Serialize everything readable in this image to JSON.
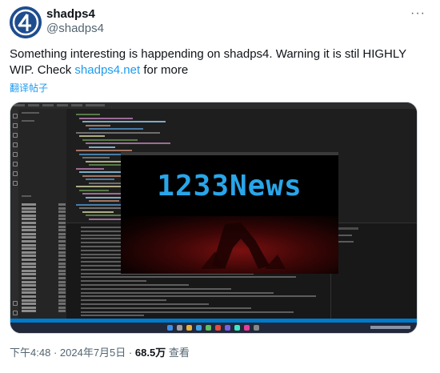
{
  "header": {
    "display_name": "shadps4",
    "handle": "@shadps4",
    "more_icon": "more-horizontal-icon"
  },
  "tweet": {
    "text_before": "Something interesting is happending on shadps4. Warning it is stil HIGHLY WIP. Check ",
    "link_text": "shadps4.net",
    "text_after": " for more",
    "translate_label": "翻译帖子"
  },
  "media": {
    "emulator_logo_text": "1233News"
  },
  "footer": {
    "time": "下午4:48",
    "separator": "·",
    "date": "2024年7月5日",
    "views_count": "68.5万",
    "views_label": "查看"
  },
  "colors": {
    "link": "#1d9bf0",
    "secondary_text": "#536471",
    "logo_blue": "#29a6ea"
  }
}
